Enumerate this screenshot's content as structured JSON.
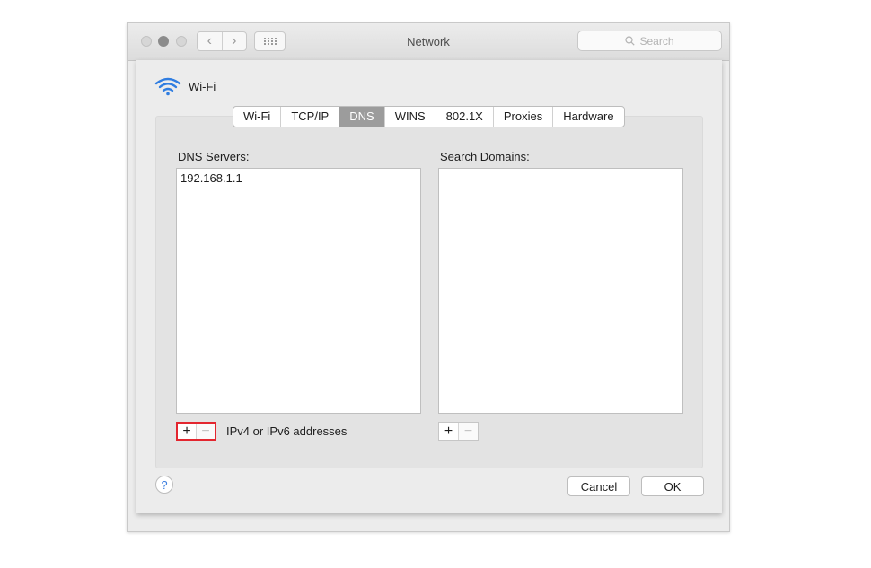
{
  "window": {
    "title": "Network"
  },
  "toolbar": {
    "back_glyph": "‹",
    "forward_glyph": "›",
    "search_placeholder": "Search"
  },
  "header": {
    "interface_name": "Wi-Fi"
  },
  "tabs": [
    {
      "label": "Wi-Fi",
      "active": false
    },
    {
      "label": "TCP/IP",
      "active": false
    },
    {
      "label": "DNS",
      "active": true
    },
    {
      "label": "WINS",
      "active": false
    },
    {
      "label": "802.1X",
      "active": false
    },
    {
      "label": "Proxies",
      "active": false
    },
    {
      "label": "Hardware",
      "active": false
    }
  ],
  "dns": {
    "servers_label": "DNS Servers:",
    "servers": [
      "192.168.1.1"
    ],
    "hint": "IPv4 or IPv6 addresses"
  },
  "search_domains": {
    "label": "Search Domains:",
    "items": []
  },
  "controls": {
    "plus": "+",
    "minus": "−"
  },
  "footer": {
    "help": "?",
    "cancel": "Cancel",
    "ok": "OK"
  },
  "colors": {
    "highlight": "#e3262f",
    "wifi_icon": "#2f7de1",
    "active_tab": "#9c9c9c"
  }
}
